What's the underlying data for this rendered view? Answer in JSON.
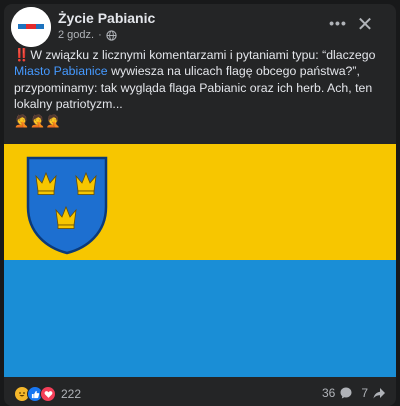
{
  "post": {
    "page_name": "Życie Pabianic",
    "time": "2 godz.",
    "separator": "·",
    "text_exclaim": "‼️",
    "text_before": "W związku z licznymi komentarzami i pytaniami typu: “dlaczego ",
    "mention": "Miasto Pabianice",
    "text_after": " wywiesza na ulicach flagę obcego państwa?”, przypominamy: tak wygląda flaga Pabianic oraz ich herb. Ach, ten lokalny patriotyzm...",
    "emojis": "🤦🤦🤦"
  },
  "header": {
    "more_label": "•••",
    "close_label": "✕"
  },
  "flag": {
    "top_color": "#f7c600",
    "bottom_color": "#1a8ed6",
    "shield_color": "#1d6fd0",
    "crown_color": "#f7c600"
  },
  "footer": {
    "reaction_count": "222",
    "comments_count": "36",
    "shares_count": "7"
  },
  "icons": {
    "avatar": "zycie-pabianic-logo",
    "globe": "globe-icon",
    "comment": "comment-icon",
    "share": "share-icon",
    "reactions": [
      "haha-reaction-icon",
      "like-reaction-icon",
      "love-reaction-icon"
    ]
  }
}
